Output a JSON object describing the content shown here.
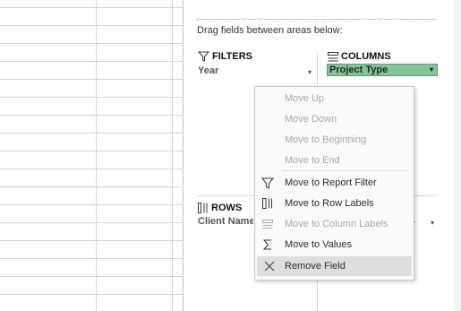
{
  "pane": {
    "instruction": "Drag fields between areas below:",
    "filters": {
      "label": "FILTERS",
      "field": "Year"
    },
    "columns": {
      "label": "COLUMNS",
      "field": "Project Type"
    },
    "rows": {
      "label": "ROWS",
      "field": "Client Name"
    }
  },
  "menu": {
    "items": [
      {
        "label": "Move Up",
        "enabled": false
      },
      {
        "label": "Move Down",
        "enabled": false
      },
      {
        "label": "Move to Beginning",
        "enabled": false
      },
      {
        "label": "Move to End",
        "enabled": false
      },
      {
        "label": "Move to Report Filter",
        "enabled": true,
        "icon": "filter-icon"
      },
      {
        "label": "Move to Row Labels",
        "enabled": true,
        "icon": "row-labels-icon"
      },
      {
        "label": "Move to Column Labels",
        "enabled": false,
        "icon": "column-labels-icon"
      },
      {
        "label": "Move to Values",
        "enabled": true,
        "icon": "sigma-icon"
      },
      {
        "label": "Remove Field",
        "enabled": true,
        "highlighted": true,
        "icon": "close-icon"
      }
    ]
  },
  "colors": {
    "pill": "#86c29b",
    "highlight": "#dedede"
  }
}
